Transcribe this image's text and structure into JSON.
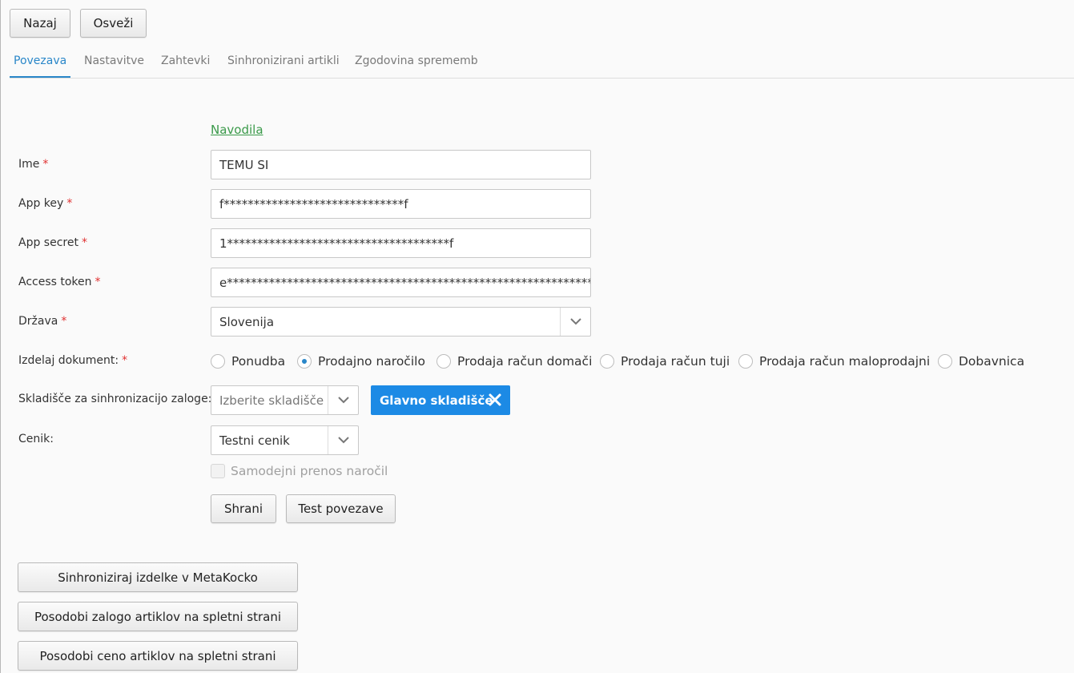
{
  "toolbar": {
    "back_label": "Nazaj",
    "refresh_label": "Osveži"
  },
  "tabs": [
    {
      "label": "Povezava",
      "active": true
    },
    {
      "label": "Nastavitve",
      "active": false
    },
    {
      "label": "Zahtevki",
      "active": false
    },
    {
      "label": "Sinhronizirani artikli",
      "active": false
    },
    {
      "label": "Zgodovina sprememb",
      "active": false
    }
  ],
  "form": {
    "instructions_link": "Navodila",
    "required_mark": "*",
    "name": {
      "label": "Ime",
      "value": "TEMU SI"
    },
    "app_key": {
      "label": "App key",
      "value": "f******************************f"
    },
    "app_secret": {
      "label": "App secret",
      "value": "1*************************************f"
    },
    "access_token": {
      "label": "Access token",
      "value": "e**************************************************************"
    },
    "country": {
      "label": "Država",
      "value": "Slovenija"
    },
    "document": {
      "label": "Izdelaj dokument:",
      "options": [
        "Ponudba",
        "Prodajno naročilo",
        "Prodaja račun domači",
        "Prodaja račun tuji",
        "Prodaja račun maloprodajni",
        "Dobavnica"
      ],
      "selected": "Prodajno naročilo"
    },
    "warehouse": {
      "label": "Skladišče za sinhronizacijo zaloge:",
      "placeholder": "Izberite skladišče",
      "selected_tag": "Glavno skladišče"
    },
    "pricelist": {
      "label": "Cenik:",
      "value": "Testni cenik"
    },
    "auto_transfer": {
      "label": "Samodejni prenos naročil",
      "checked": false,
      "disabled": true
    },
    "save_label": "Shrani",
    "test_label": "Test povezave"
  },
  "actions": {
    "sync_products": "Sinhroniziraj izdelke v MetaKocko",
    "update_stock": "Posodobi zalogo artiklov na spletni strani",
    "update_price": "Posodobi ceno artiklov na spletni strani"
  },
  "colors": {
    "accent": "#2a87c9",
    "tag_bg": "#1c8ae5",
    "required": "#e03131",
    "link": "#3a9a4a"
  }
}
